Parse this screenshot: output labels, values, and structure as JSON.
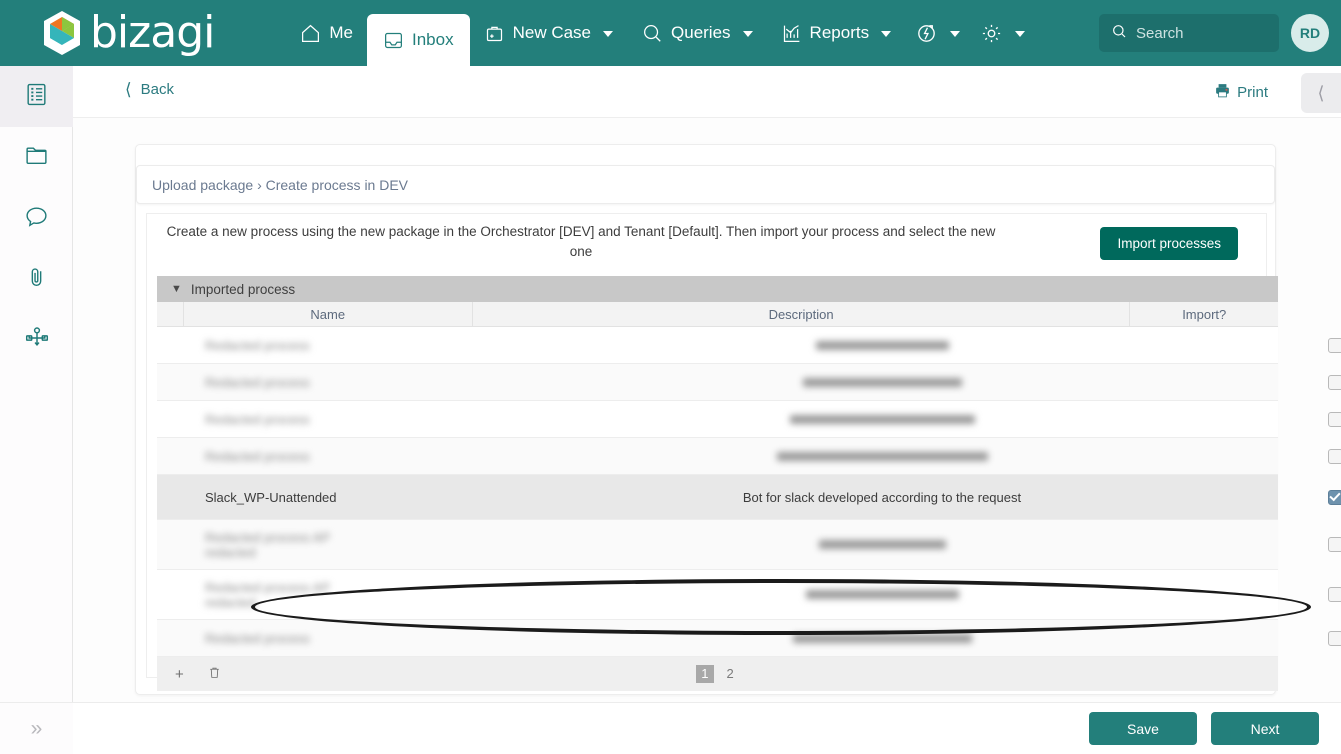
{
  "brand": {
    "name": "bizagi",
    "accent_teal": "#237f7b",
    "logo_orange": "#ef7622",
    "logo_green": "#8cc63e",
    "logo_cyan": "#35b5ba",
    "button_green": "#00695c"
  },
  "topnav": {
    "items": [
      {
        "label": "Me",
        "icon": "home-icon",
        "active": false,
        "caret": false
      },
      {
        "label": "Inbox",
        "icon": "inbox-icon",
        "active": true,
        "caret": false
      },
      {
        "label": "New Case",
        "icon": "briefcase-plus-icon",
        "active": false,
        "caret": true
      },
      {
        "label": "Queries",
        "icon": "magnifier-icon",
        "active": false,
        "caret": true
      },
      {
        "label": "Reports",
        "icon": "bar-chart-icon",
        "active": false,
        "caret": true
      }
    ],
    "automation_icon": "automation-icon",
    "settings_icon": "gear-icon",
    "search": {
      "placeholder": "Search",
      "value": "",
      "icon": "search-icon"
    },
    "avatar_initials": "RD"
  },
  "rail": {
    "items": [
      {
        "icon": "form-list-icon",
        "selected": true
      },
      {
        "icon": "folder-icon",
        "selected": false
      },
      {
        "icon": "comment-icon",
        "selected": false
      },
      {
        "icon": "paperclip-icon",
        "selected": false
      },
      {
        "icon": "process-diagram-icon",
        "selected": false
      }
    ],
    "expand_label": "»"
  },
  "actionbar": {
    "back_label": "Back",
    "back_icon": "chevron-left-icon",
    "print_label": "Print",
    "print_icon": "printer-icon",
    "collapse_icon": "chevron-left-icon"
  },
  "breadcrumb": {
    "text": "Upload package › Create process in DEV"
  },
  "panel": {
    "instruction": "Create a new process using the new package in the Orchestrator [DEV] and Tenant [Default]. Then import your process and select the new one",
    "import_button": "Import processes"
  },
  "grid": {
    "section_title": "Imported process",
    "section_chevron": "chevron-down-icon",
    "columns": {
      "name": "Name",
      "description": "Description",
      "import": "Import?"
    },
    "rows": [
      {
        "name": "",
        "description": "",
        "checked": false,
        "redacted": true,
        "alt": false,
        "selected": false,
        "two_line": false
      },
      {
        "name": "",
        "description": "",
        "checked": false,
        "redacted": true,
        "alt": true,
        "selected": false,
        "two_line": false
      },
      {
        "name": "",
        "description": "",
        "checked": false,
        "redacted": true,
        "alt": false,
        "selected": false,
        "two_line": false
      },
      {
        "name": "",
        "description": "",
        "checked": false,
        "redacted": true,
        "alt": true,
        "selected": false,
        "two_line": false
      },
      {
        "name": "Slack_WP-Unattended",
        "description": "Bot for slack developed according to the request",
        "checked": true,
        "redacted": false,
        "alt": false,
        "selected": true,
        "two_line": false
      },
      {
        "name": "",
        "description": "",
        "checked": false,
        "redacted": true,
        "alt": true,
        "selected": false,
        "two_line": true
      },
      {
        "name": "",
        "description": "",
        "checked": false,
        "redacted": true,
        "alt": false,
        "selected": false,
        "two_line": true
      },
      {
        "name": "",
        "description": "",
        "checked": false,
        "redacted": true,
        "alt": true,
        "selected": false,
        "two_line": false
      }
    ],
    "footer": {
      "add_icon": "plus-icon",
      "delete_icon": "trash-icon",
      "pages": [
        {
          "label": "1",
          "current": true
        },
        {
          "label": "2",
          "current": false
        }
      ]
    }
  },
  "footer": {
    "save_label": "Save",
    "next_label": "Next"
  }
}
